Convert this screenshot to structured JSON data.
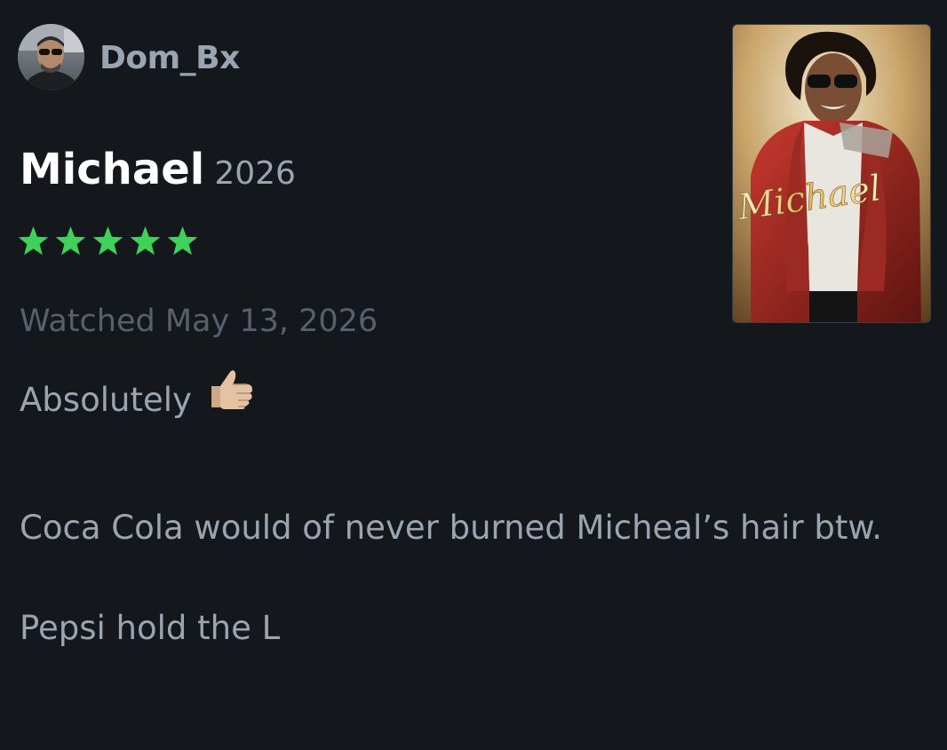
{
  "review": {
    "username": "Dom_Bx",
    "film_title": "Michael",
    "film_year": "2026",
    "rating_stars": 5,
    "watched_date": "Watched May 13, 2026",
    "line1": "Absolutely",
    "line1_emoji": "thumbs-up-icon",
    "paragraph2": "Coca Cola would of never burned Micheal’s hair btw.",
    "paragraph3": "Pepsi hold the L"
  },
  "poster": {
    "title_art": "Michael"
  },
  "colors": {
    "background": "#14181c",
    "star": "#40d15a",
    "muted_text": "#9aa5b1",
    "date_text": "#56616d"
  }
}
